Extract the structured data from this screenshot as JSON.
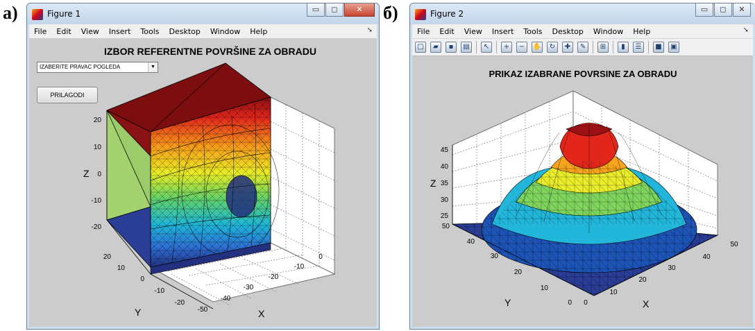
{
  "panels": [
    {
      "letter": "а)",
      "window_title": "Figure 1",
      "menu": [
        "File",
        "Edit",
        "View",
        "Insert",
        "Tools",
        "Desktop",
        "Window",
        "Help"
      ],
      "plot_title": "IZBOR REFERENTNE POVRŠINE ZA OBRADU",
      "dropdown_value": "IZABERITE PRAVAC POGLEDA",
      "button_label": "PRILAGODI",
      "z_ticks": [
        "20",
        "10",
        "0",
        "-10",
        "-20"
      ],
      "y_ticks": [
        "20",
        "10",
        "0",
        "-10",
        "-20"
      ],
      "x_ticks": [
        "-50",
        "-40",
        "-30",
        "-20",
        "-10",
        "0"
      ],
      "zlabel": "Z",
      "ylabel": "Y",
      "xlabel": "X"
    },
    {
      "letter": "б)",
      "window_title": "Figure 2",
      "menu": [
        "File",
        "Edit",
        "View",
        "Insert",
        "Tools",
        "Desktop",
        "Window",
        "Help"
      ],
      "plot_title": "PRIKAZ IZABRANE POVRSINE ZA OBRADU",
      "z_ticks": [
        "45",
        "40",
        "35",
        "30",
        "25"
      ],
      "y_ticks": [
        "50",
        "40",
        "30",
        "20",
        "10",
        "0"
      ],
      "x_ticks": [
        "0",
        "10",
        "20",
        "30",
        "40",
        "50"
      ],
      "zlabel": "Z",
      "ylabel": "Y",
      "xlabel": "X"
    }
  ],
  "icons": {
    "minimize": "minimize-icon",
    "maximize": "maximize-icon",
    "close": "close-icon",
    "app": "matlab-figure-icon",
    "pin": "dock-arrow-icon"
  },
  "colors": {
    "surface_dark_red": "#7d0e10",
    "surface_green": "#9ccc6a",
    "surface_blue": "#2a3d97",
    "figure_bg": "#cccccc"
  }
}
